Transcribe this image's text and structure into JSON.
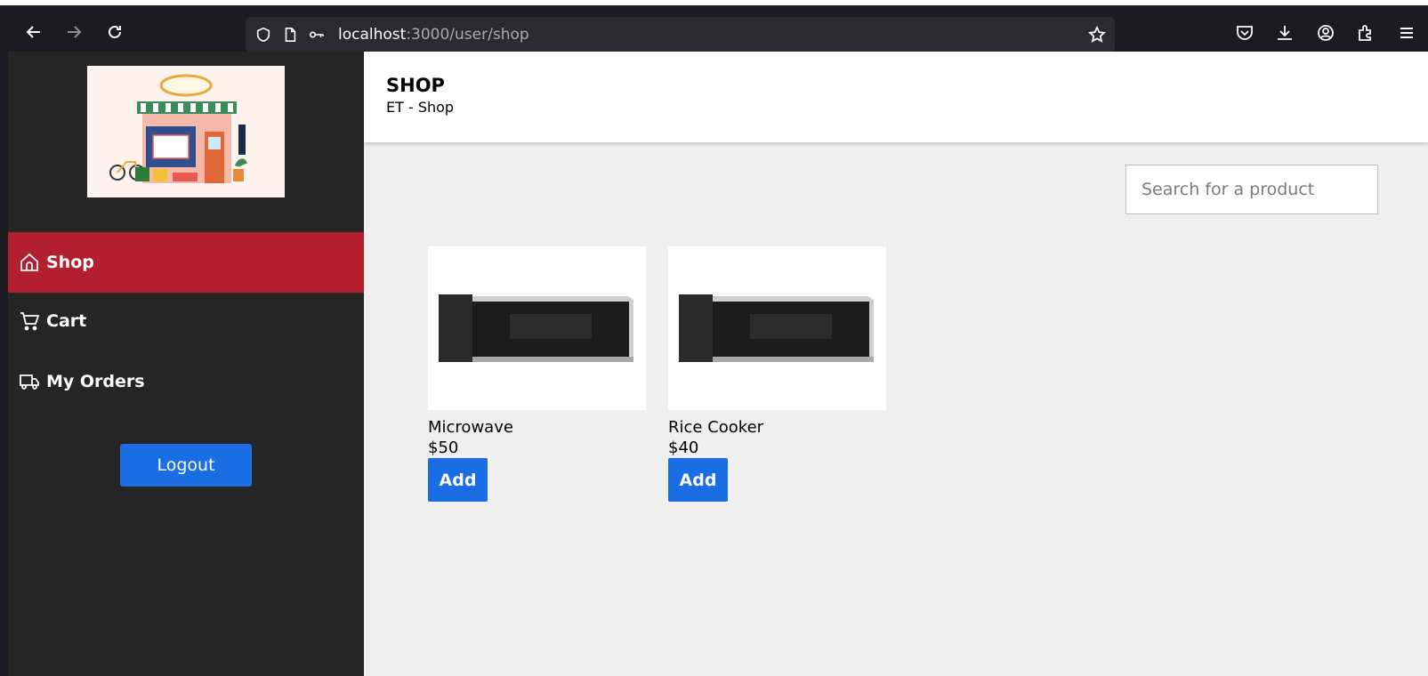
{
  "browser": {
    "url_host": "localhost",
    "url_path": ":3000/user/shop"
  },
  "sidebar": {
    "logo_alt": "STORE",
    "items": [
      {
        "label": "Shop",
        "icon": "home-icon",
        "active": true
      },
      {
        "label": "Cart",
        "icon": "cart-icon",
        "active": false
      },
      {
        "label": "My Orders",
        "icon": "truck-icon",
        "active": false
      }
    ],
    "logout_label": "Logout"
  },
  "header": {
    "title": "SHOP",
    "subtitle": "ET - Shop"
  },
  "search": {
    "placeholder": "Search for a product"
  },
  "products": [
    {
      "name": "Microwave",
      "price": "$50",
      "add_label": "Add"
    },
    {
      "name": "Rice Cooker",
      "price": "$40",
      "add_label": "Add"
    }
  ],
  "colors": {
    "accent_red": "#b41f30",
    "button_blue": "#1a6de2",
    "sidebar_bg": "#252525",
    "main_bg": "#efefef"
  }
}
